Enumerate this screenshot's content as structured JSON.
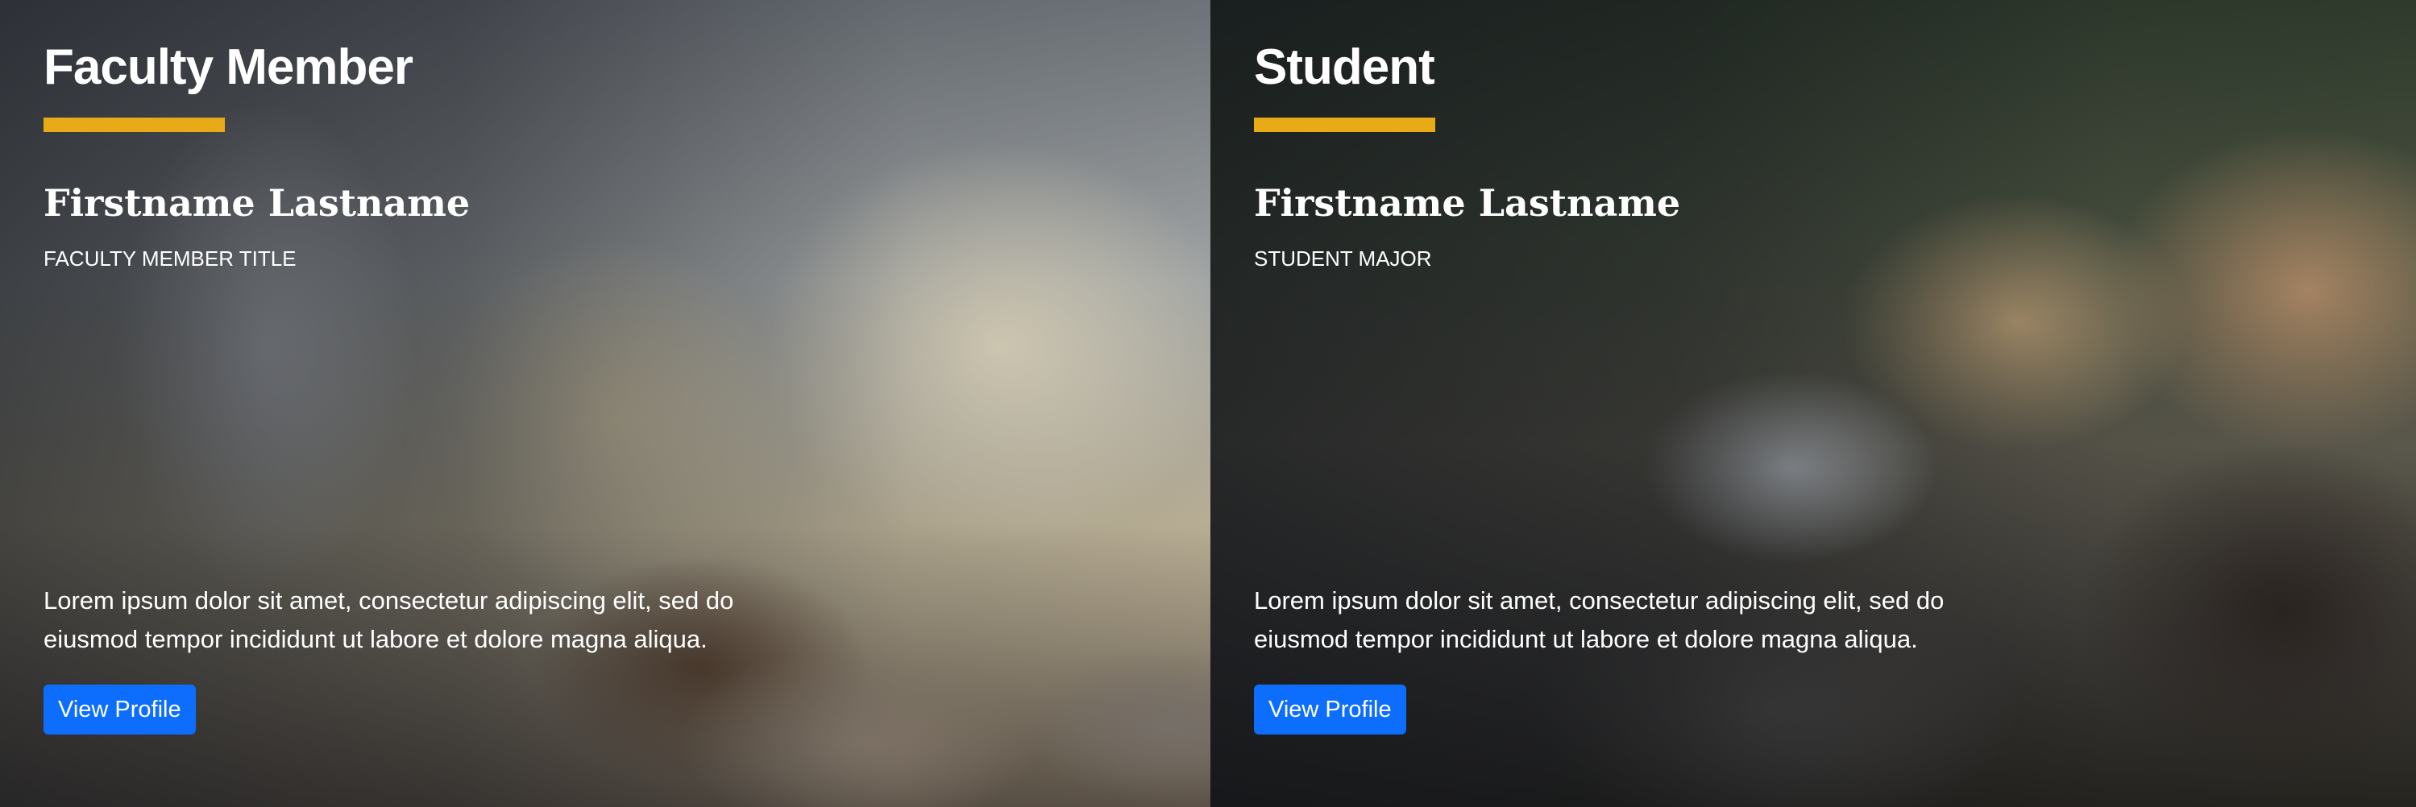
{
  "cards": [
    {
      "role": "Faculty Member",
      "name": "Firstname Lastname",
      "subtitle": "FACULTY MEMBER TITLE",
      "description": "Lorem ipsum dolor sit amet, consectetur adipiscing elit, sed do eiusmod tempor incididunt ut labore et dolore magna aliqua.",
      "button_label": "View Profile"
    },
    {
      "role": "Student",
      "name": "Firstname Lastname",
      "subtitle": "STUDENT MAJOR",
      "description": "Lorem ipsum dolor sit amet, consectetur adipiscing elit, sed do eiusmod tempor incididunt ut labore et dolore magna aliqua.",
      "button_label": "View Profile"
    }
  ],
  "colors": {
    "accent": "#e8ab17",
    "button": "#0d6efd",
    "text": "#ffffff"
  }
}
